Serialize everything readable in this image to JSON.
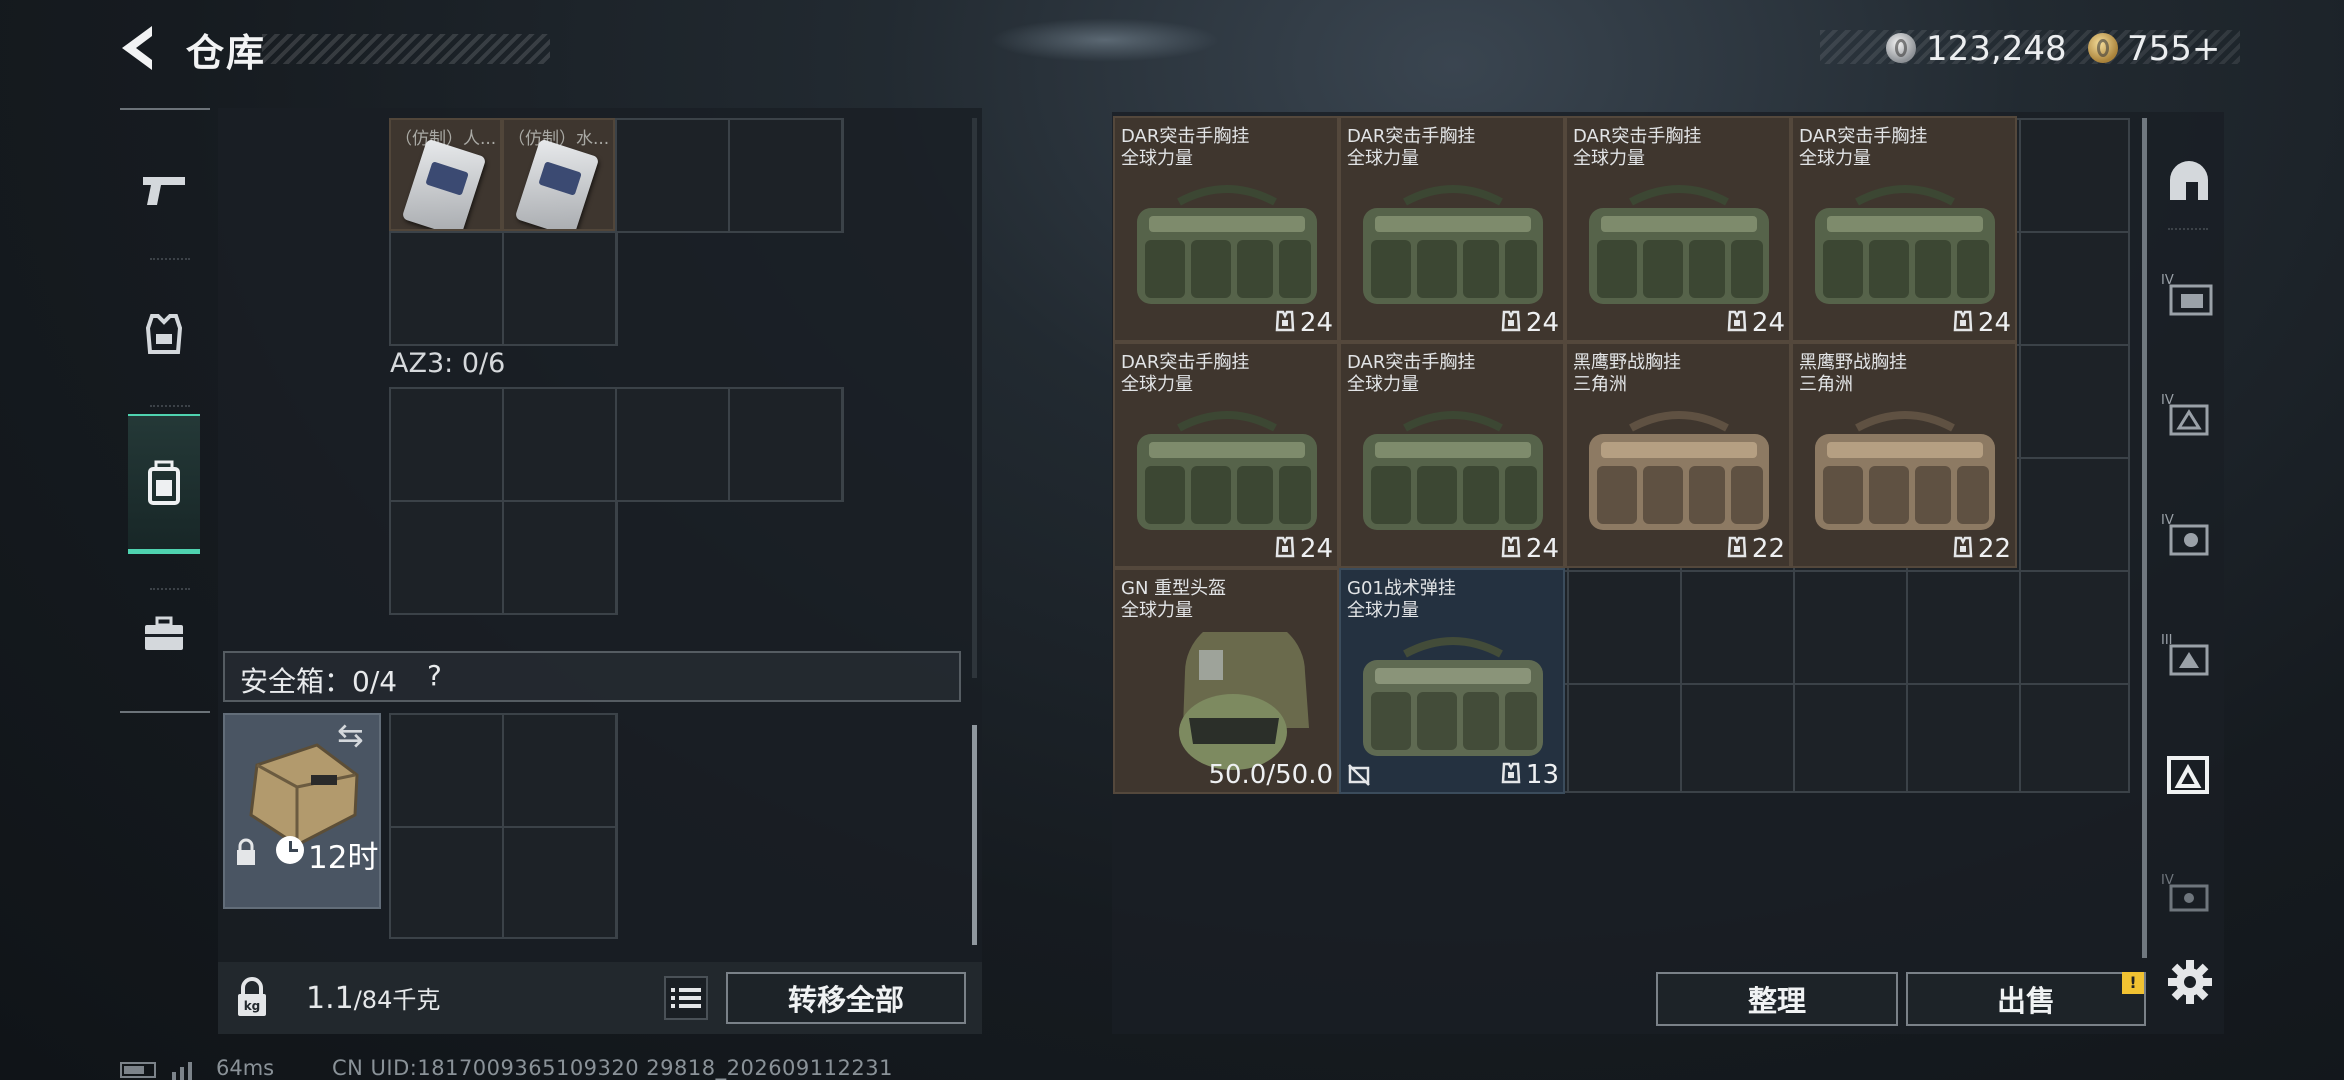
{
  "header": {
    "title": "仓库",
    "back_icon": "chevron-left-icon"
  },
  "currency": {
    "silver": "123,248",
    "gold": "755",
    "gold_add": "+"
  },
  "left_nav": [
    {
      "name": "weapon",
      "icon": "pistol-icon"
    },
    {
      "name": "armor",
      "icon": "armor-vest-icon"
    },
    {
      "name": "backpack",
      "icon": "backpack-icon",
      "active": true
    },
    {
      "name": "case",
      "icon": "briefcase-icon"
    }
  ],
  "loadout": {
    "top_items": [
      {
        "label": "（仿制）人..."
      },
      {
        "label": "（仿制）水..."
      }
    ],
    "az3_label": "AZ3: 0/6",
    "safe_box": {
      "label": "安全箱：0/4",
      "help": "?",
      "timer": "12时"
    }
  },
  "weight": {
    "current": "1.1",
    "max": "/84",
    "unit": "千克"
  },
  "buttons": {
    "transfer_all": "转移全部",
    "sort": "整理",
    "sell": "出售",
    "sell_badge": "!"
  },
  "stash_items": [
    {
      "line1": "DAR突击手胸挂",
      "line2": "全球力量",
      "capacity": "24",
      "tint": "green"
    },
    {
      "line1": "DAR突击手胸挂",
      "line2": "全球力量",
      "capacity": "24",
      "tint": "green"
    },
    {
      "line1": "DAR突击手胸挂",
      "line2": "全球力量",
      "capacity": "24",
      "tint": "green"
    },
    {
      "line1": "DAR突击手胸挂",
      "line2": "全球力量",
      "capacity": "24",
      "tint": "green"
    },
    {
      "line1": "DAR突击手胸挂",
      "line2": "全球力量",
      "capacity": "24",
      "tint": "green"
    },
    {
      "line1": "DAR突击手胸挂",
      "line2": "全球力量",
      "capacity": "24",
      "tint": "green"
    },
    {
      "line1": "黑鹰野战胸挂",
      "line2": "三角洲",
      "capacity": "22",
      "tint": "tan"
    },
    {
      "line1": "黑鹰野战胸挂",
      "line2": "三角洲",
      "capacity": "22",
      "tint": "tan"
    },
    {
      "line1": "GN 重型头盔",
      "line2": "全球力量",
      "durability": "50.0/50.0",
      "type": "helmet"
    },
    {
      "line1": "G01战术弹挂",
      "line2": "全球力量",
      "capacity": "13",
      "tint": "olive",
      "bg": "blue"
    }
  ],
  "right_nav": [
    "helmet-icon",
    "armor-iv-icon",
    "rig-iv-icon",
    "backpack-iv-icon",
    "rig-iii-icon",
    "rig-selected-icon",
    "rig-iv-small-icon"
  ],
  "status": {
    "ping": "64ms",
    "uid": "CN UID:1817009365109320 29818_202609112231"
  }
}
